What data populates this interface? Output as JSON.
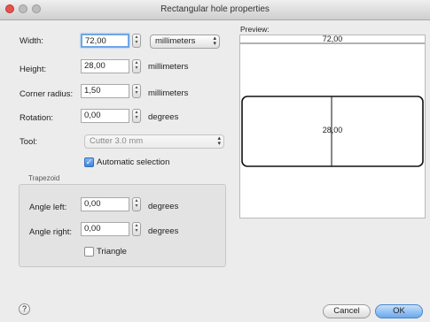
{
  "window": {
    "title": "Rectangular hole properties"
  },
  "labels": {
    "width": "Width:",
    "height": "Height:",
    "corner_radius": "Corner radius:",
    "rotation": "Rotation:",
    "tool": "Tool:",
    "preview": "Preview:"
  },
  "fields": {
    "width": "72,00",
    "height": "28,00",
    "corner_radius": "1,50",
    "rotation": "0,00",
    "angle_left": "0,00",
    "angle_right": "0,00"
  },
  "units": {
    "width_select": "millimeters",
    "height": "millimeters",
    "corner_radius": "millimeters",
    "rotation": "degrees",
    "angle_left": "degrees",
    "angle_right": "degrees"
  },
  "tool_select": "Cutter 3.0 mm",
  "automatic_selection": {
    "label": "Automatic selection",
    "checked": true
  },
  "trapezoid": {
    "title": "Trapezoid",
    "angle_left_label": "Angle left:",
    "angle_right_label": "Angle right:",
    "triangle_label": "Triangle",
    "triangle_checked": false
  },
  "preview": {
    "width_text": "72,00",
    "height_text": "28,00"
  },
  "buttons": {
    "cancel": "Cancel",
    "ok": "OK",
    "help": "?"
  }
}
